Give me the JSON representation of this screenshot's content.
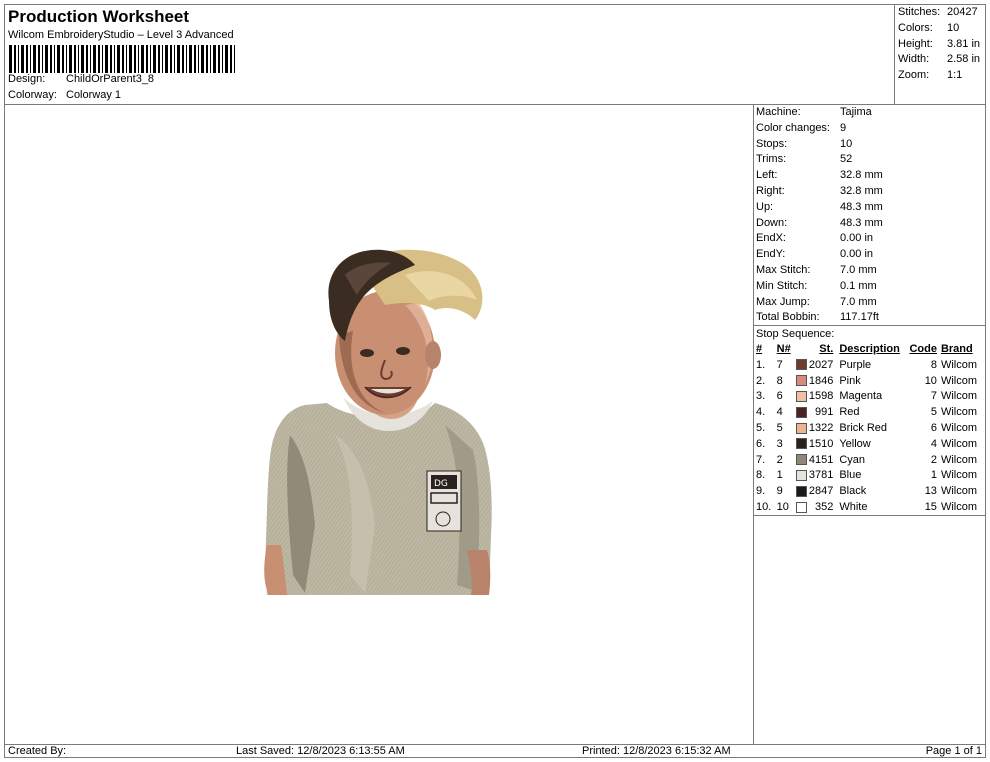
{
  "header": {
    "title": "Production Worksheet",
    "subtitle": "Wilcom EmbroideryStudio – Level 3 Advanced",
    "design_label": "Design:",
    "design_value": "ChildOrParent3_8",
    "colorway_label": "Colorway:",
    "colorway_value": "Colorway 1"
  },
  "stats": [
    {
      "label": "Stitches:",
      "value": "20427"
    },
    {
      "label": "Colors:",
      "value": "10"
    },
    {
      "label": "Height:",
      "value": "3.81 in"
    },
    {
      "label": "Width:",
      "value": "2.58 in"
    },
    {
      "label": "Zoom:",
      "value": "1:1"
    }
  ],
  "machine_info": [
    {
      "label": "Machine:",
      "value": "Tajima"
    },
    {
      "label": "Color changes:",
      "value": "9"
    },
    {
      "label": "Stops:",
      "value": "10"
    },
    {
      "label": "Trims:",
      "value": "52"
    },
    {
      "label": "Left:",
      "value": "32.8 mm"
    },
    {
      "label": "Right:",
      "value": "32.8 mm"
    },
    {
      "label": "Up:",
      "value": "48.3 mm"
    },
    {
      "label": "Down:",
      "value": "48.3 mm"
    },
    {
      "label": "EndX:",
      "value": "0.00 in"
    },
    {
      "label": "EndY:",
      "value": "0.00 in"
    },
    {
      "label": "Max Stitch:",
      "value": "7.0 mm"
    },
    {
      "label": "Min Stitch:",
      "value": "0.1 mm"
    },
    {
      "label": "Max Jump:",
      "value": "7.0 mm"
    },
    {
      "label": "Total Bobbin:",
      "value": "117.17ft"
    }
  ],
  "stop_sequence": {
    "title": "Stop Sequence:",
    "headers": {
      "idx": "#",
      "n": "N#",
      "st": "St.",
      "desc": "Description",
      "code": "Code",
      "brand": "Brand"
    },
    "rows": [
      {
        "idx": "1.",
        "n": "7",
        "color": "#6e3b2e",
        "st": "2027",
        "desc": "Purple",
        "code": "8",
        "brand": "Wilcom"
      },
      {
        "idx": "2.",
        "n": "8",
        "color": "#d98b7a",
        "st": "1846",
        "desc": "Pink",
        "code": "10",
        "brand": "Wilcom"
      },
      {
        "idx": "3.",
        "n": "6",
        "color": "#f0c0a2",
        "st": "1598",
        "desc": "Magenta",
        "code": "7",
        "brand": "Wilcom"
      },
      {
        "idx": "4.",
        "n": "4",
        "color": "#4a2420",
        "st": "991",
        "desc": "Red",
        "code": "5",
        "brand": "Wilcom"
      },
      {
        "idx": "5.",
        "n": "5",
        "color": "#e9b48e",
        "st": "1322",
        "desc": "Brick Red",
        "code": "6",
        "brand": "Wilcom"
      },
      {
        "idx": "6.",
        "n": "3",
        "color": "#2a211e",
        "st": "1510",
        "desc": "Yellow",
        "code": "4",
        "brand": "Wilcom"
      },
      {
        "idx": "7.",
        "n": "2",
        "color": "#8f8778",
        "st": "4151",
        "desc": "Cyan",
        "code": "2",
        "brand": "Wilcom"
      },
      {
        "idx": "8.",
        "n": "1",
        "color": "#e6e3dc",
        "st": "3781",
        "desc": "Blue",
        "code": "1",
        "brand": "Wilcom"
      },
      {
        "idx": "9.",
        "n": "9",
        "color": "#1a1a1a",
        "st": "2847",
        "desc": "Black",
        "code": "13",
        "brand": "Wilcom"
      },
      {
        "idx": "10.",
        "n": "10",
        "color": "#ffffff",
        "st": "352",
        "desc": "White",
        "code": "15",
        "brand": "Wilcom"
      }
    ]
  },
  "footer": {
    "created_by": "Created By:",
    "last_saved": "Last Saved: 12/8/2023 6:13:55 AM",
    "printed": "Printed: 12/8/2023 6:15:32 AM",
    "page": "Page 1 of 1"
  },
  "colors": {
    "border": "#7a7a7a",
    "shirt": "#b7b19c",
    "skin": "#c88f72",
    "hair_dark": "#3b2c22",
    "hair_light": "#d8bf86"
  }
}
